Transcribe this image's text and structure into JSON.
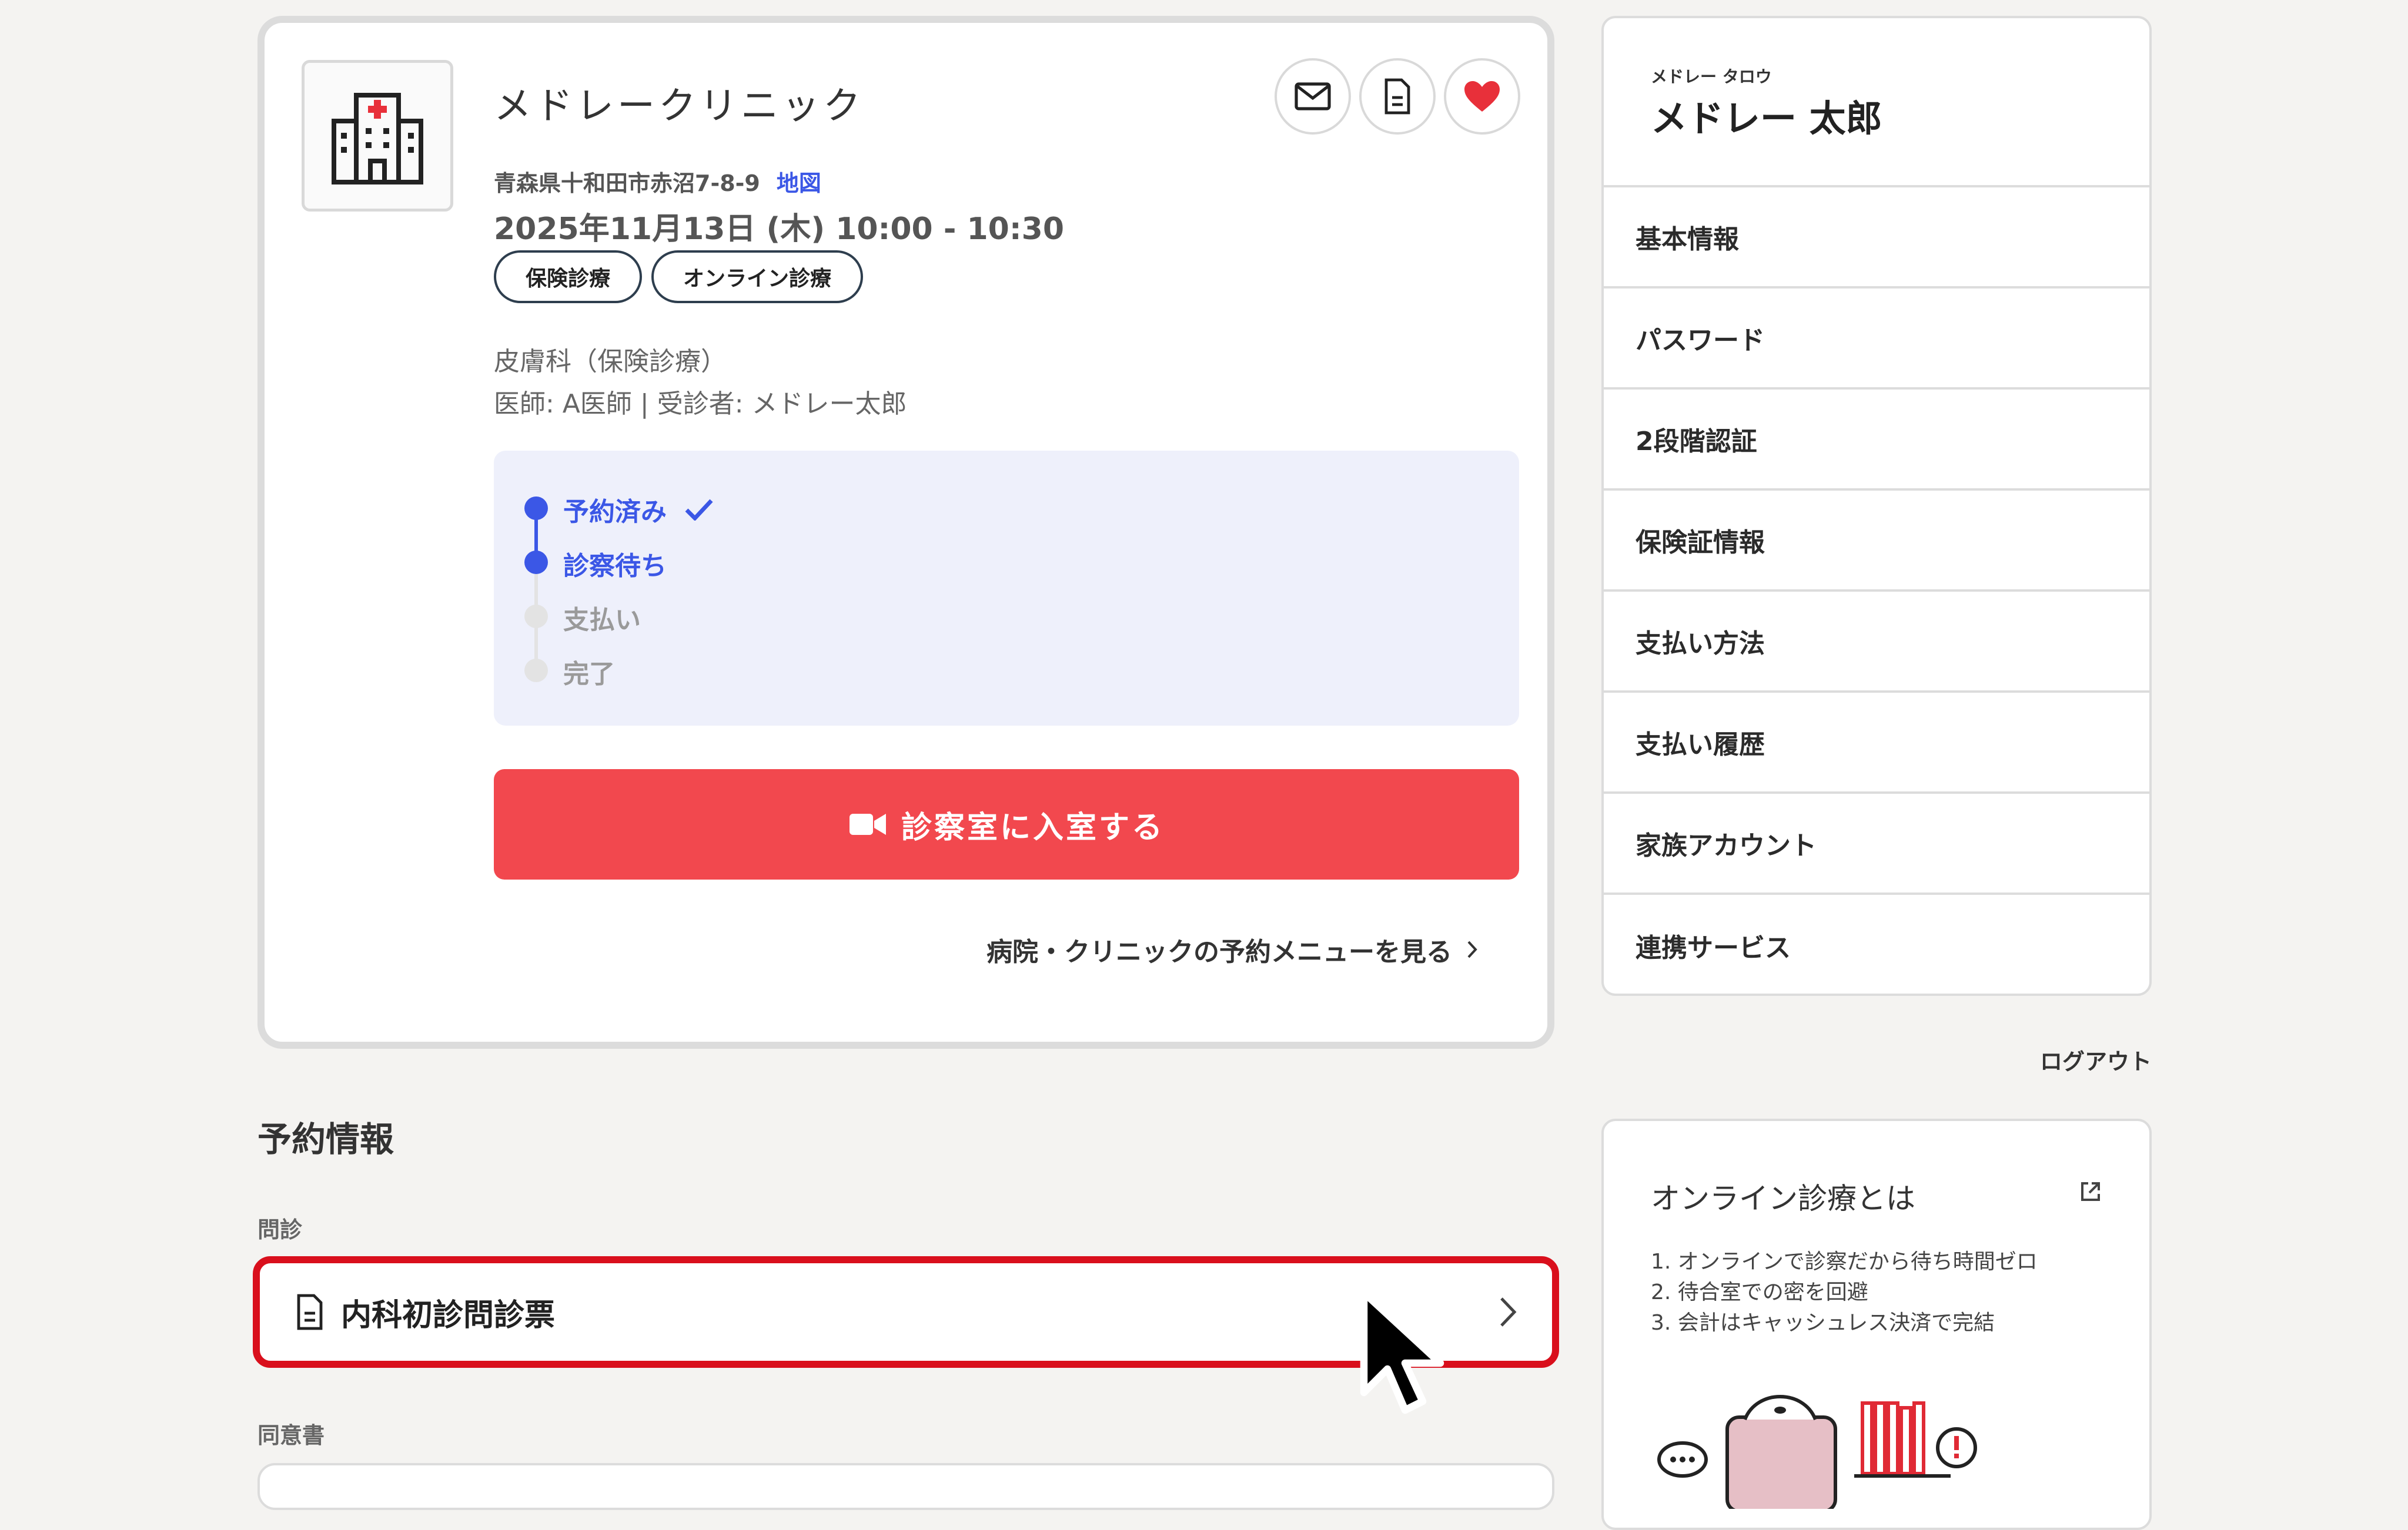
{
  "clinic": {
    "name": "メドレークリニック",
    "address": "青森県十和田市赤沼7-8-9",
    "map_link": "地図",
    "datetime": "2025年11月13日 (木) 10:00 - 10:30",
    "tags": [
      "保険診療",
      "オンライン診療"
    ],
    "department": "皮膚科（保険診療）",
    "doctor_line": "医師: A医師 | 受診者: メドレー太郎",
    "icons": [
      "hospital-icon",
      "mail-icon",
      "document-icon",
      "heart-icon"
    ]
  },
  "status_steps": [
    {
      "label": "予約済み",
      "state": "done"
    },
    {
      "label": "診察待ち",
      "state": "current"
    },
    {
      "label": "支払い",
      "state": "pending"
    },
    {
      "label": "完了",
      "state": "pending"
    }
  ],
  "join_button": {
    "label": "診察室に入室する",
    "icon": "video-camera-icon"
  },
  "menu_link": "病院・クリニックの予約メニューを見る",
  "reservation": {
    "title": "予約情報",
    "monshin_label": "問診",
    "monshin_item": "内科初診問診票",
    "consent_label": "同意書"
  },
  "user": {
    "kana": "メドレー タロウ",
    "name": "メドレー 太郎"
  },
  "sidebar_items": [
    "基本情報",
    "パスワード",
    "2段階認証",
    "保険証情報",
    "支払い方法",
    "支払い履歴",
    "家族アカウント",
    "連携サービス"
  ],
  "logout": "ログアウト",
  "info_card": {
    "title": "オンライン診療とは",
    "points": [
      "1. オンラインで診察だから待ち時間ゼロ",
      "2. 待合室での密を回避",
      "3. 会計はキャッシュレス決済で完結"
    ]
  },
  "colors": {
    "accent_blue": "#3b57e6",
    "join_red": "#f2484e",
    "highlight_red": "#d90f1c",
    "heart_red": "#e8303a"
  }
}
